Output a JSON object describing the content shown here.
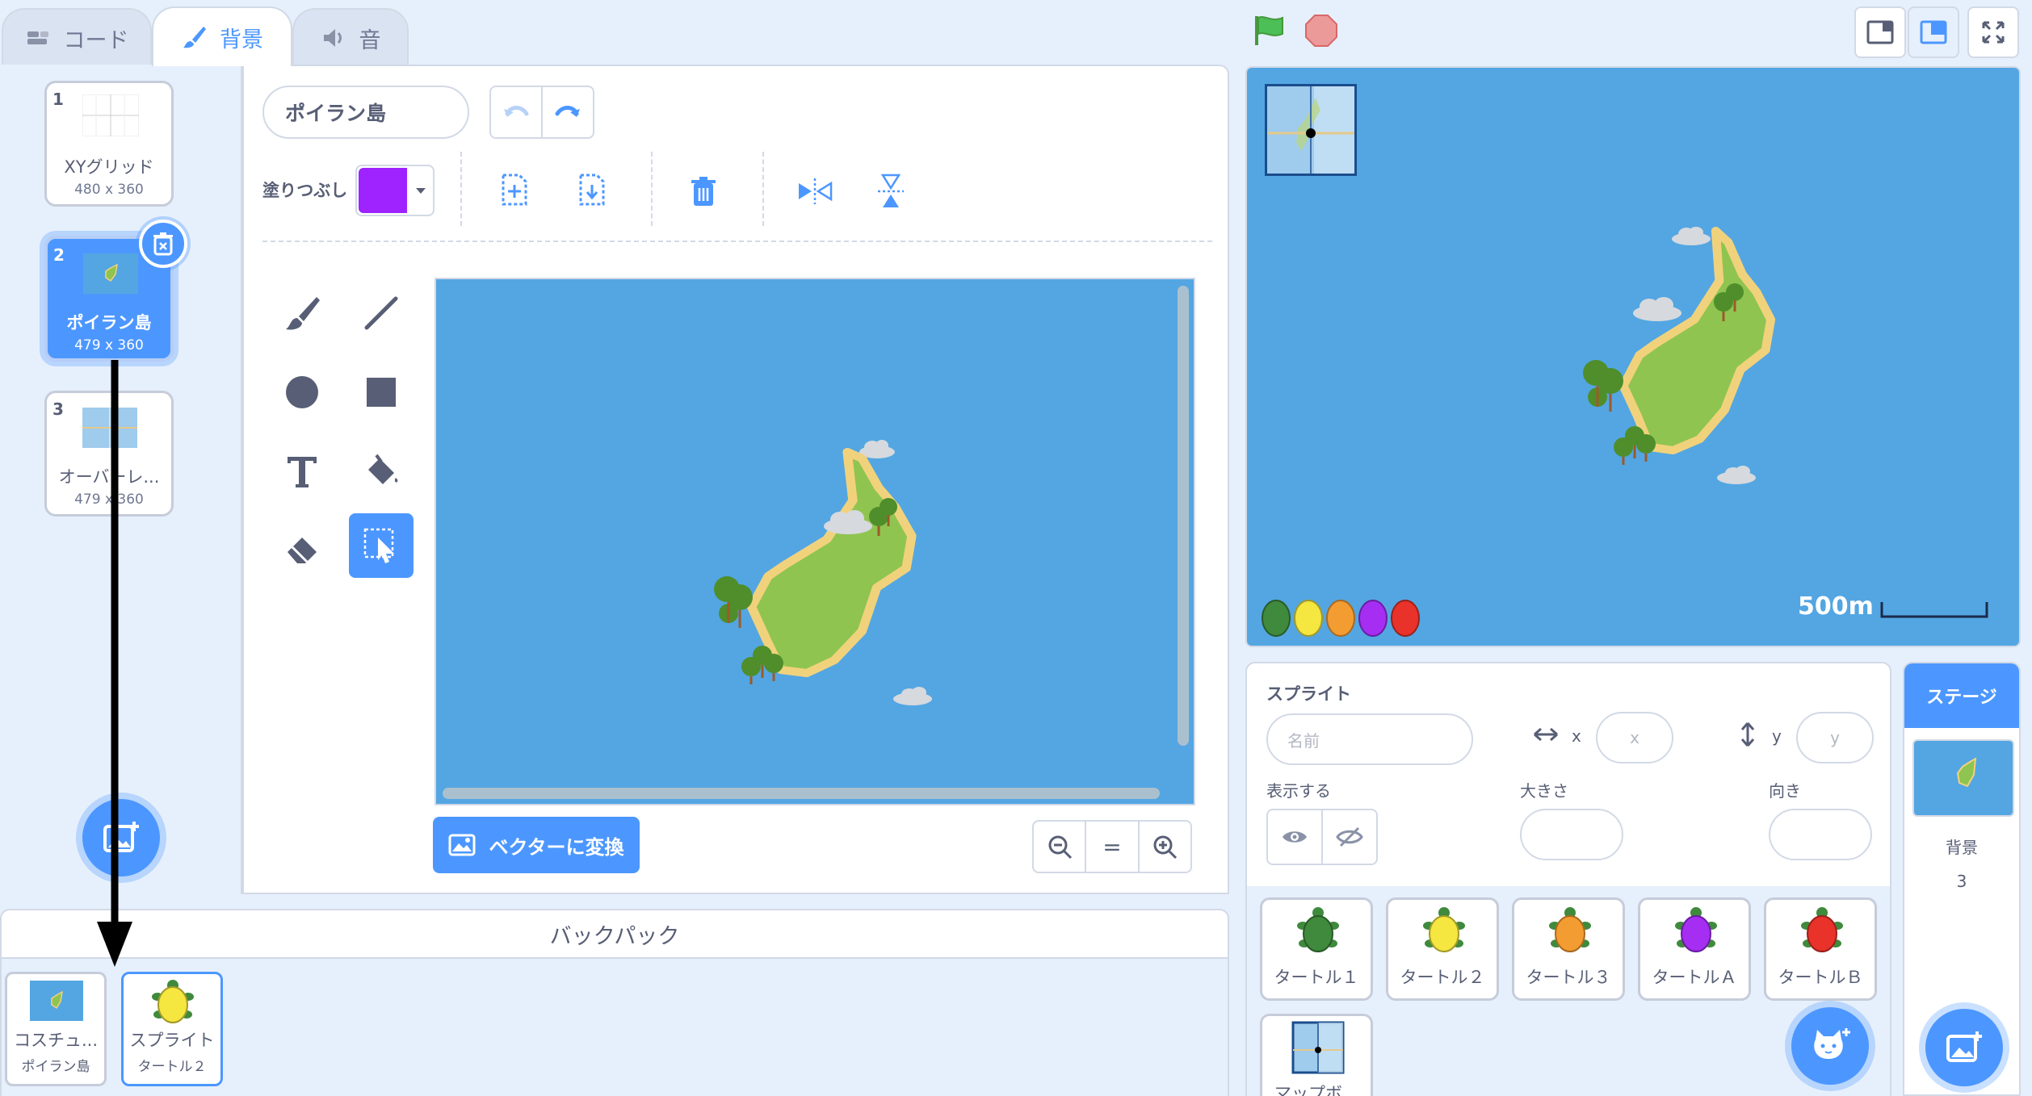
{
  "tabs": [
    {
      "label": "コード",
      "icon": "code-icon"
    },
    {
      "label": "背景",
      "icon": "paintbrush-icon"
    },
    {
      "label": "音",
      "icon": "speaker-icon"
    }
  ],
  "costumes": [
    {
      "num": "1",
      "name": "XYグリッド",
      "size": "480 x 360"
    },
    {
      "num": "2",
      "name": "ポイラン島",
      "size": "479 x 360"
    },
    {
      "num": "3",
      "name": "オーバーレ...",
      "size": "479 x 360"
    }
  ],
  "editor": {
    "costume_name": "ポイラン島",
    "fill_label": "塗りつぶし",
    "fill_color": "#9e23ff",
    "convert_button": "ベクターに変換",
    "zoom_reset": "="
  },
  "backpack": {
    "title": "バックパック",
    "items": [
      {
        "line1": "コスチュ...",
        "line2": "ポイラン島"
      },
      {
        "line1": "スプライト",
        "line2": "タートル２"
      }
    ]
  },
  "stage": {
    "scale_label": "500m"
  },
  "sprite_info": {
    "heading": "スプライト",
    "name_placeholder": "名前",
    "x_label": "x",
    "x_placeholder": "x",
    "y_label": "y",
    "y_placeholder": "y",
    "show_label": "表示する",
    "size_label": "大きさ",
    "direction_label": "向き"
  },
  "sprites": [
    {
      "label": "タートル１",
      "color": "#3f8a3c"
    },
    {
      "label": "タートル２",
      "color": "#f5e640"
    },
    {
      "label": "タートル３",
      "color": "#f39c32"
    },
    {
      "label": "タートルＡ",
      "color": "#a52ef2"
    },
    {
      "label": "タートルＢ",
      "color": "#e8322a"
    },
    {
      "label": "マップボ..."
    }
  ],
  "stage_panel": {
    "header": "ステージ",
    "backdrops_label": "背景",
    "backdrops_count": "3"
  }
}
